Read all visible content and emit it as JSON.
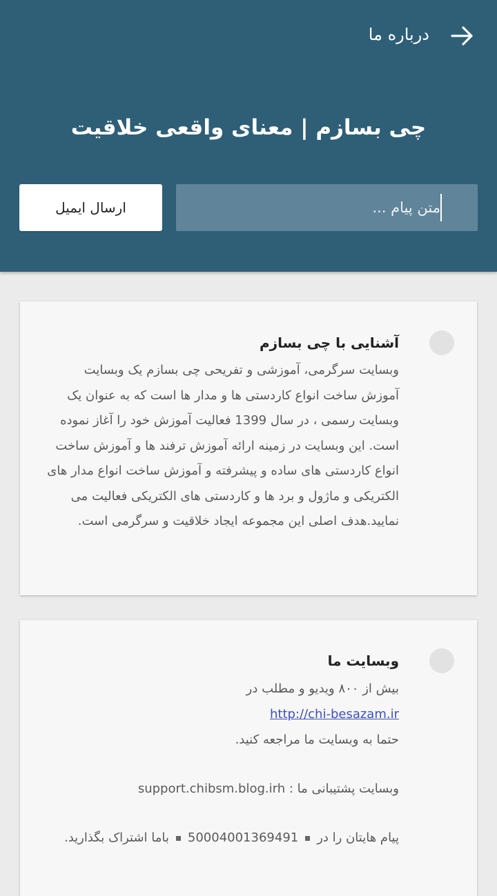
{
  "appbar": {
    "title": "درباره ما",
    "back_icon": "arrow-right-icon"
  },
  "hero": {
    "title": "چی بسازم | معنای واقعی خلاقیت"
  },
  "form": {
    "message_placeholder": "متن پیام ...",
    "send_label": "ارسال ایمیل"
  },
  "cards": [
    {
      "title": "آشنایی با چی بسازم",
      "text": "وبسایت سرگرمی، آموزشی و تفریحی چی بسازم یک وبسایت آموزش ساخت انواع کاردستی ها و مدار ها است که به عنوان یک وبسایت رسمی ، در سال 1399 فعالیت آموزش خود را آغاز نموده است. این وبسایت در زمینه ارائه آموزش ترفند ها و آموزش ساخت انواع کاردستی های ساده و پیشرفته و آموزش ساخت انواع مدار های الکتریکی و ماژول و برد ها و کاردستی های الکتریکی فعالیت می نمایید.هدف اصلی این مجموعه ایجاد خلاقیت و سرگرمی است."
    },
    {
      "title": "وبسایت ما",
      "line1": "بیش از ۸۰۰ ویدیو و مطلب در",
      "link": "http://chi-besazam.ir",
      "line2": "حتما به وبسایت ما مراجعه کنید.",
      "support_label": "وبسایت پشتیبانی ما :",
      "support_value": "support.chibsm.blog.irh",
      "msg_prefix": "پیام هایتان را در",
      "msg_number": "50004001369491",
      "msg_suffix": "باما اشتراک بگذارید."
    }
  ],
  "colors": {
    "header_bg": "#2e5f77",
    "input_bg": "#60849a",
    "page_bg": "#ebebeb",
    "card_bg": "#f7f7f7",
    "link": "#3b4fc4"
  }
}
